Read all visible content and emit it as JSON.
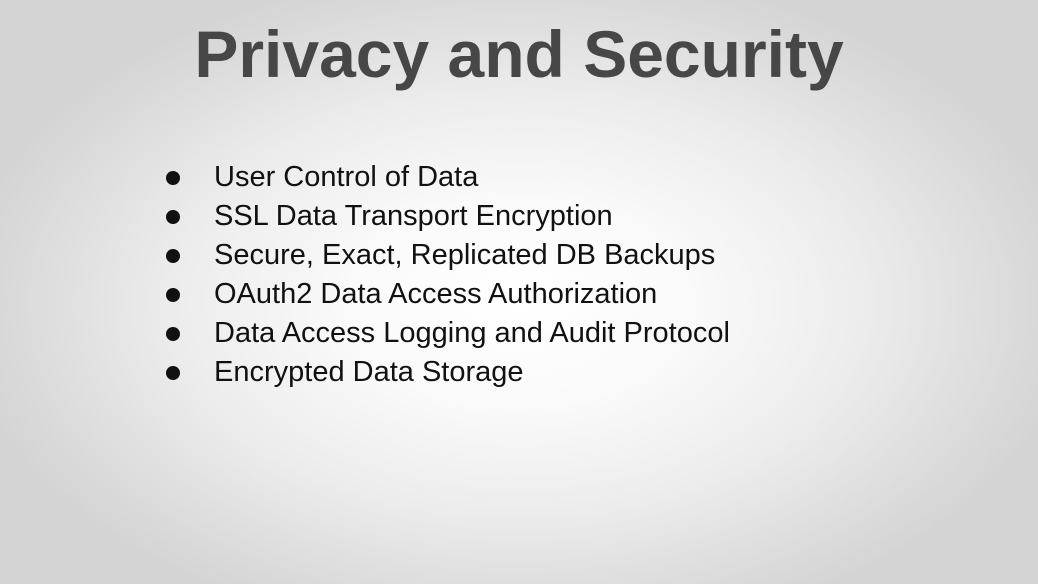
{
  "slide": {
    "title": "Privacy and Security",
    "bullets": [
      "User Control of Data",
      "SSL Data Transport Encryption",
      "Secure, Exact, Replicated DB Backups",
      "OAuth2 Data Access Authorization",
      "Data Access Logging and Audit Protocol",
      "Encrypted Data Storage"
    ]
  },
  "colors": {
    "title": "#474747",
    "text": "#111111",
    "background_center": "#ffffff",
    "background_edge": "#d4d4d4"
  }
}
